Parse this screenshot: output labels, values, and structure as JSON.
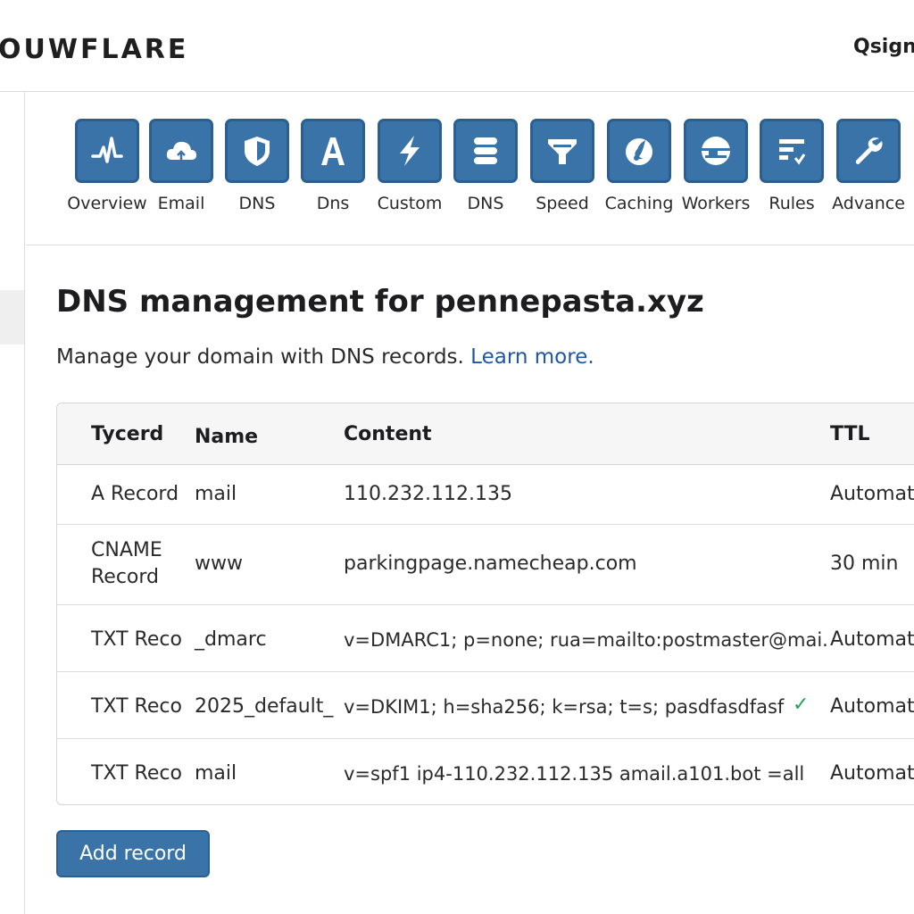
{
  "header": {
    "logo_text": "OUWFLARE",
    "user_label": "Qsign"
  },
  "apps": [
    {
      "label": "Overview",
      "icon": "pulse-icon"
    },
    {
      "label": "Email",
      "icon": "cloud-icon"
    },
    {
      "label": "DNS",
      "icon": "shield-icon"
    },
    {
      "label": "Dns",
      "icon": "letter-a-icon"
    },
    {
      "label": "Custom",
      "icon": "lightning-icon"
    },
    {
      "label": "DNS",
      "icon": "database-icon"
    },
    {
      "label": "Speed",
      "icon": "filter-icon"
    },
    {
      "label": "Caching",
      "icon": "firefox-icon"
    },
    {
      "label": "Workers",
      "icon": "globe-icon"
    },
    {
      "label": "Rules",
      "icon": "rules-list-icon"
    },
    {
      "label": "Advance",
      "icon": "wrench-icon"
    }
  ],
  "page": {
    "title": "DNS management for pennepasta.xyz",
    "subtitle": "Manage your domain with DNS records.",
    "learn_more": "Learn more."
  },
  "table": {
    "headers": {
      "type": "Tycerd",
      "name": "Name",
      "content": "Content",
      "ttl": "TTL"
    },
    "rows": [
      {
        "type": "A Record",
        "name": "mail",
        "content": "110.232.112.135",
        "ttl": "Automati"
      },
      {
        "type": "CNAME Record",
        "name": "www",
        "content": "parkingpage.namecheap.com",
        "ttl": "30 min"
      },
      {
        "type": "TXT Reco",
        "name": "_dmarc",
        "content": "v=DMARC1; p=none; rua=mailto:postmaster@mai.",
        "ttl": "Automati"
      },
      {
        "type": "TXT Reco",
        "name": "2025_default_",
        "content": "v=DKIM1; h=sha256; k=rsa; t=s; pasdfasdfasf",
        "ttl": "Automati",
        "verified": true
      },
      {
        "type": "TXT Reco",
        "name": "mail",
        "content": "v=spf1 ip4-110.232.112.135 amail.a101.bot =all",
        "ttl": "Automati"
      }
    ]
  },
  "actions": {
    "add_record": "Add record",
    "check_mark": "✓"
  },
  "colors": {
    "accent": "#3a73a8",
    "link": "#1f56a8",
    "verified": "#1fa35d"
  }
}
